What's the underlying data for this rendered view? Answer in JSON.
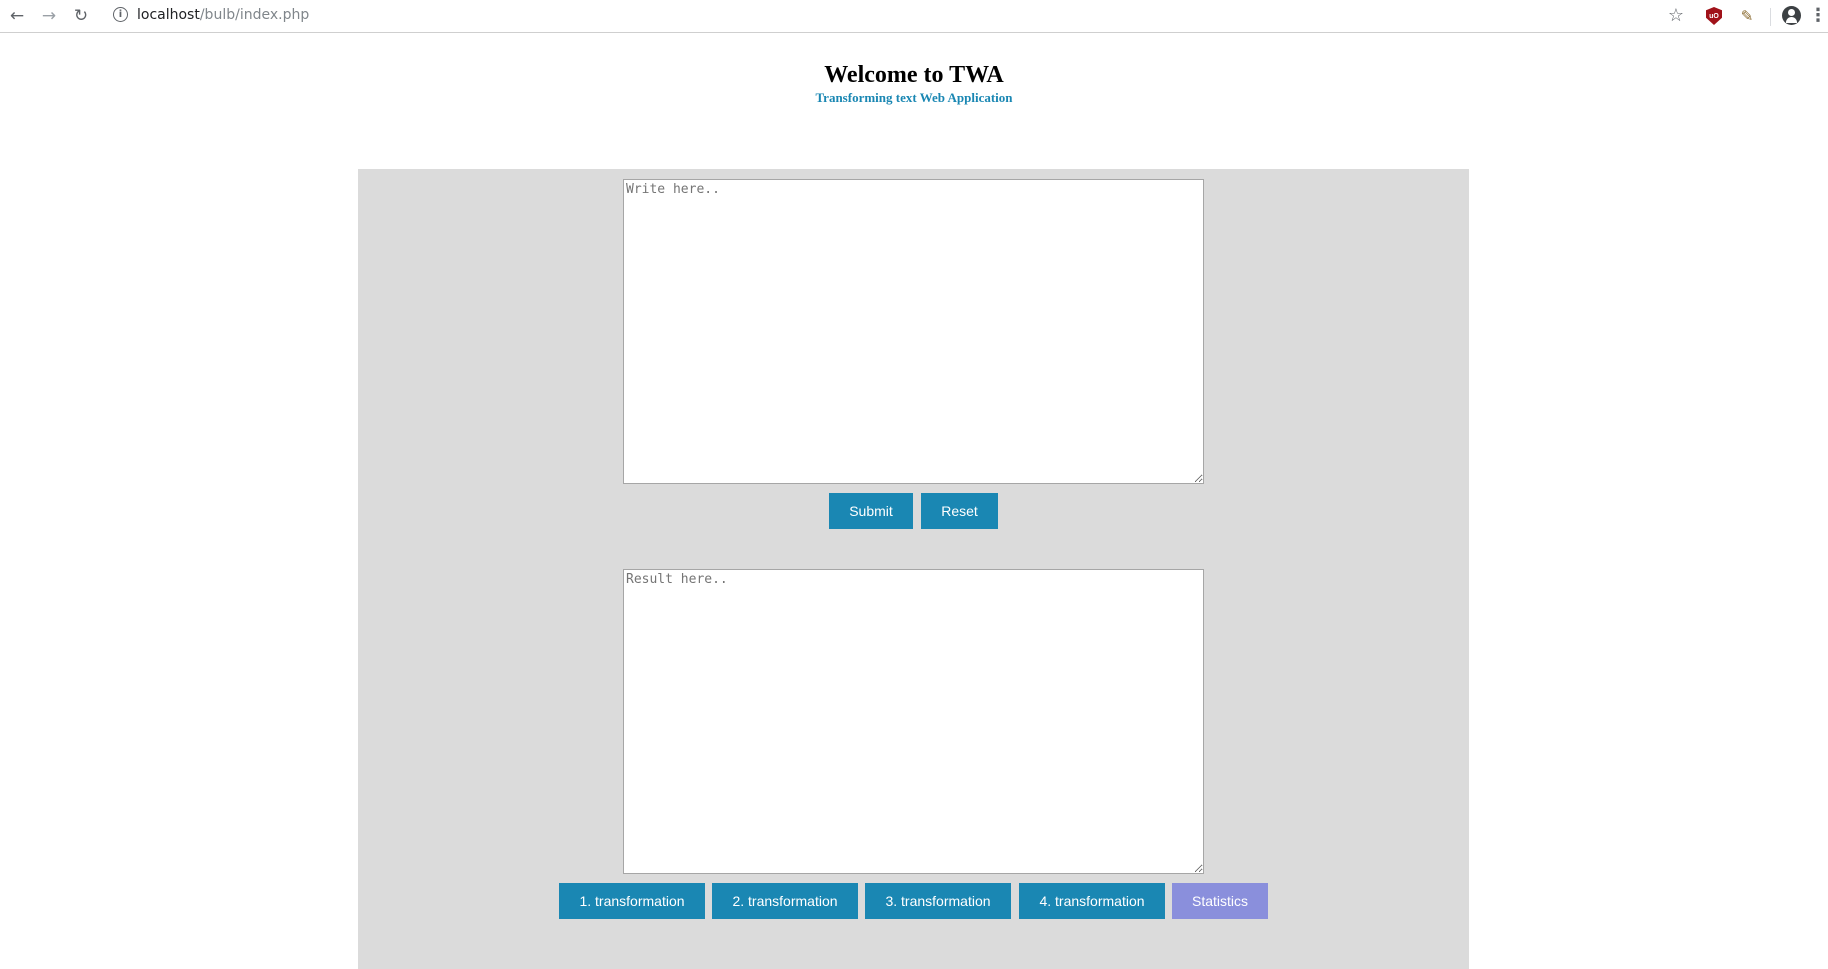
{
  "browser": {
    "url_host": "localhost",
    "url_path": "/bulb/index.php",
    "icons": {
      "back": "back-arrow-icon",
      "forward": "forward-arrow-icon",
      "reload": "reload-icon",
      "info": "info-icon",
      "bookmark": "star-icon",
      "ublock": "ublock-origin-icon",
      "extension": "extension-icon",
      "account": "account-icon",
      "menu": "kebab-menu-icon"
    }
  },
  "header": {
    "title": "Welcome to TWA",
    "subtitle": "Transforming text Web Application"
  },
  "input": {
    "placeholder": "Write here..",
    "value": ""
  },
  "form": {
    "submit_label": "Submit",
    "reset_label": "Reset"
  },
  "result": {
    "placeholder": "Result here..",
    "value": ""
  },
  "actions": {
    "transformation_1": "1. transformation",
    "transformation_2": "2. transformation",
    "transformation_3": "3. transformation",
    "transformation_4": "4. transformation",
    "statistics": "Statistics"
  },
  "colors": {
    "primary_button": "#1a87b3",
    "statistics_button": "#8a8fdc",
    "panel_background": "#dbdbdb",
    "subtitle": "#1a87b3"
  }
}
